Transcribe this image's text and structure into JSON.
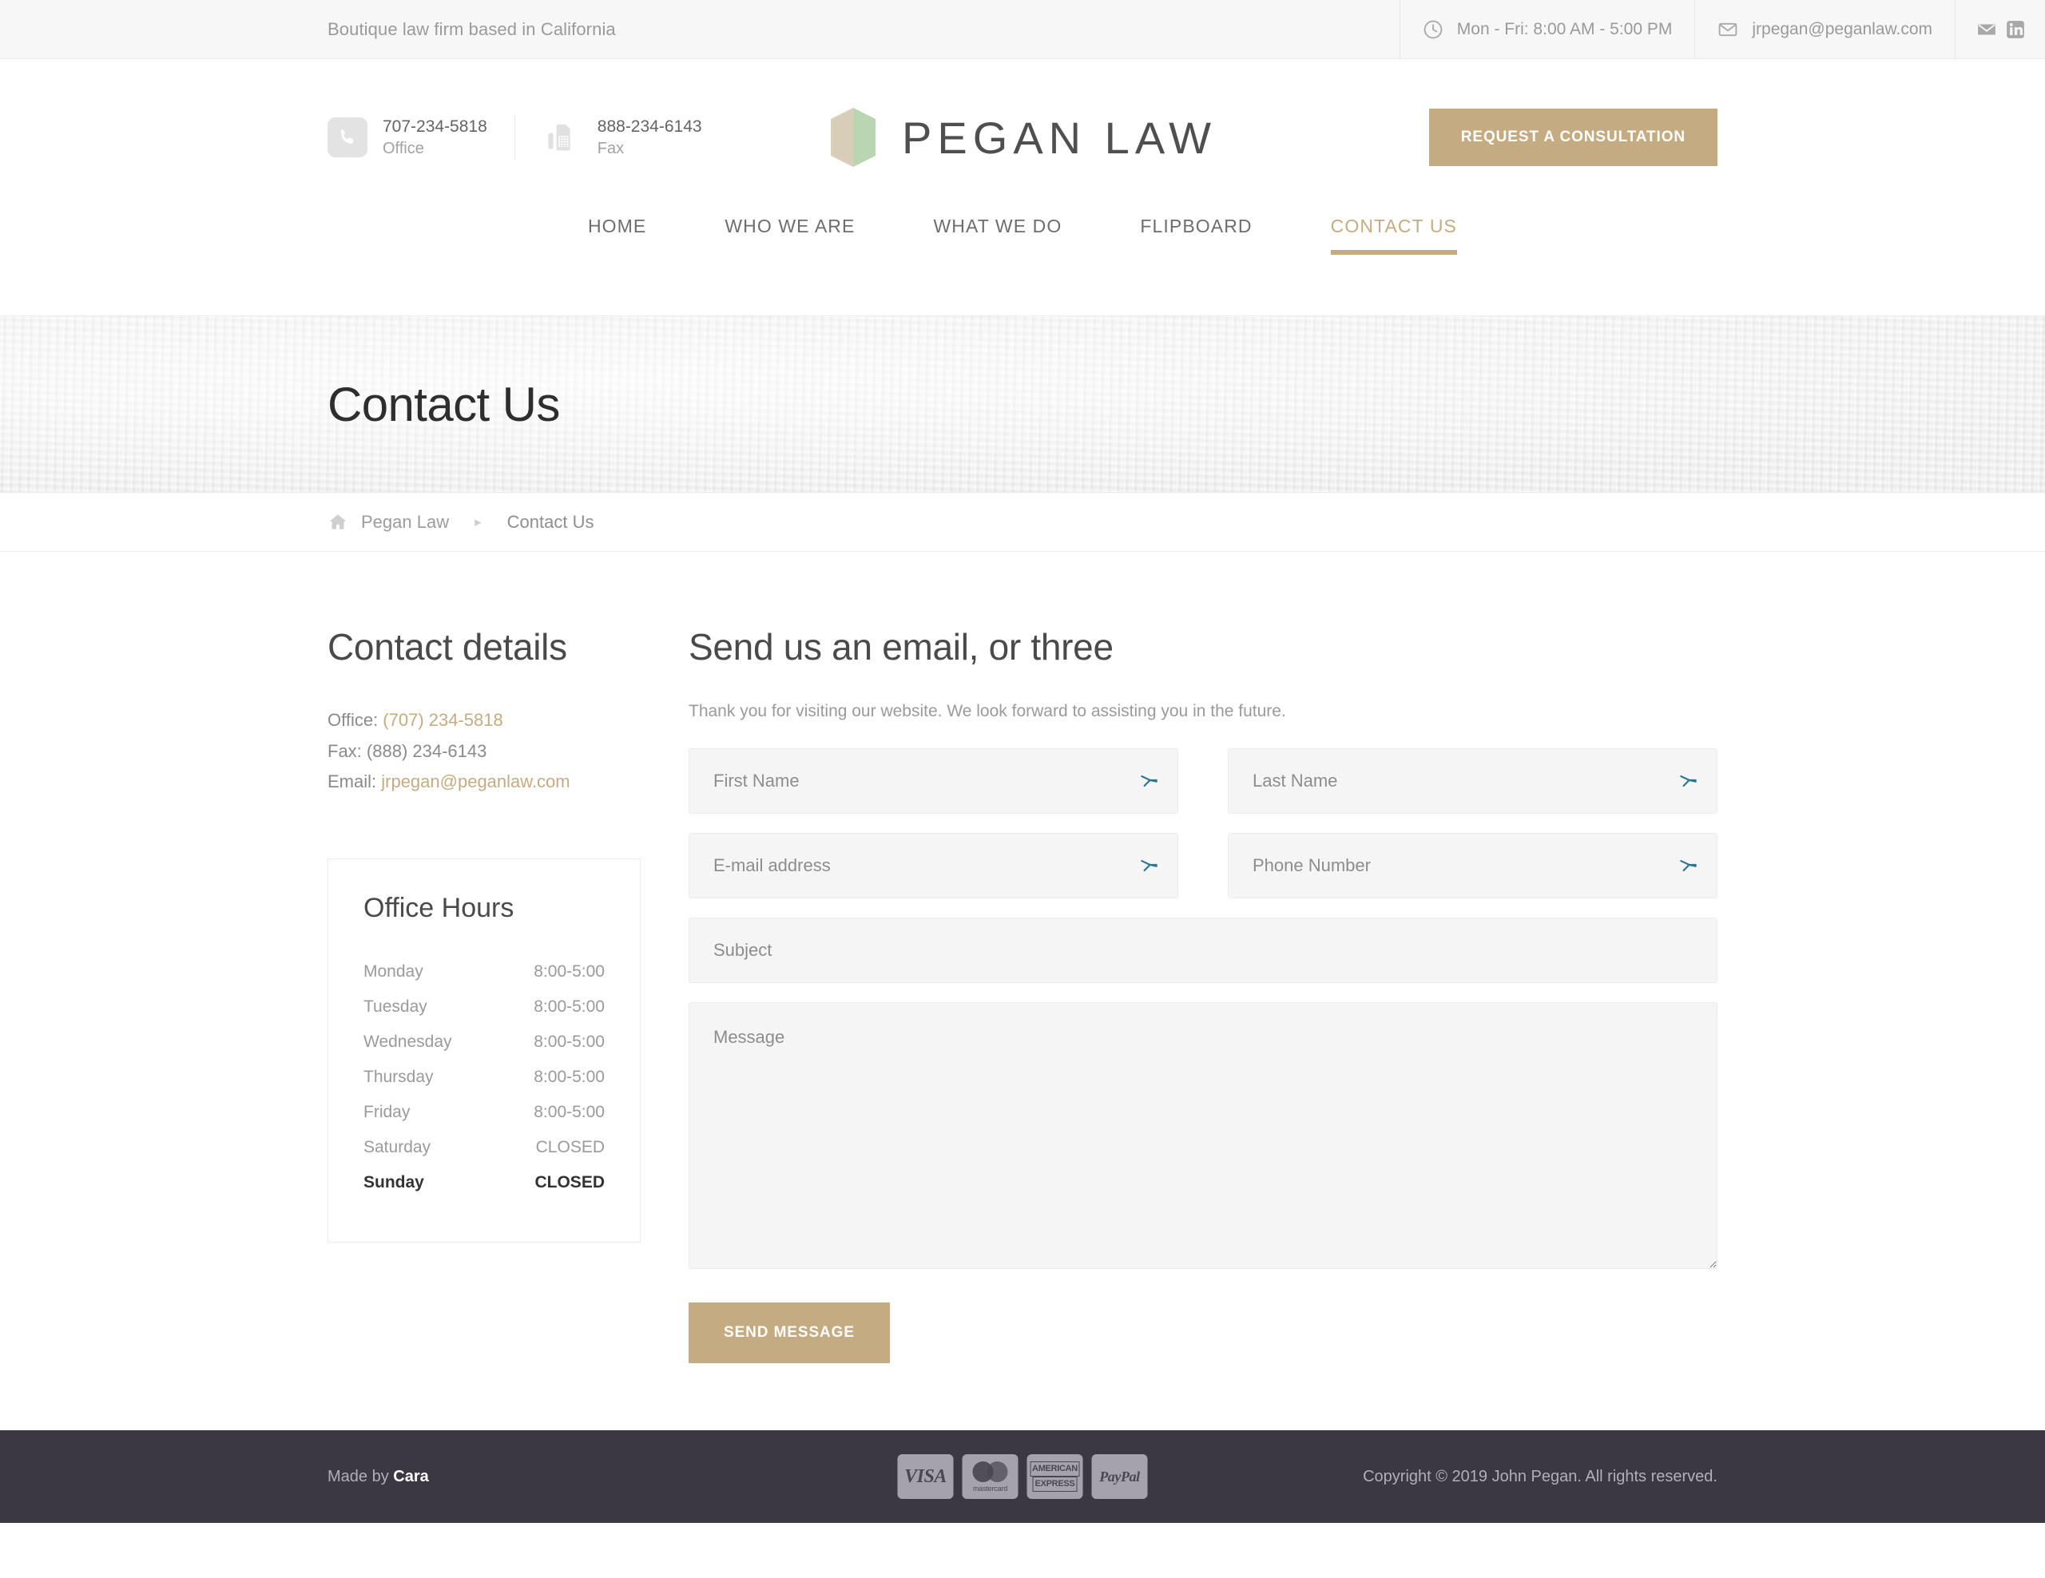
{
  "topbar": {
    "tagline": "Boutique law firm based in California",
    "hours": "Mon - Fri: 8:00 AM - 5:00 PM",
    "email": "jrpegan@peganlaw.com",
    "hours_icon": "clock-icon",
    "email_icon": "envelope-icon",
    "social": [
      {
        "name": "email-icon",
        "label": "Email"
      },
      {
        "name": "linkedin-icon",
        "label": "LinkedIn"
      }
    ]
  },
  "header": {
    "office_number": "707-234-5818",
    "office_label": "Office",
    "fax_number": "888-234-6143",
    "fax_label": "Fax",
    "brand": "PEGAN LAW",
    "cta_label": "REQUEST A CONSULTATION",
    "logo_left_color": "#d8cdb9",
    "logo_right_color": "#bad6b1",
    "accent_color": "#c5ab81"
  },
  "nav": {
    "items": [
      {
        "label": "HOME",
        "active": false
      },
      {
        "label": "WHO WE ARE",
        "active": false
      },
      {
        "label": "WHAT WE DO",
        "active": false
      },
      {
        "label": "FLIPBOARD",
        "active": false
      },
      {
        "label": "CONTACT US",
        "active": true
      }
    ]
  },
  "banner": {
    "title": "Contact Us"
  },
  "breadcrumb": {
    "home_icon": "home-icon",
    "items": [
      {
        "label": "Pegan Law",
        "current": false
      },
      {
        "label": "Contact Us",
        "current": true
      }
    ],
    "separator": "▸"
  },
  "contact_details": {
    "title": "Contact details",
    "office_prefix": "Office: ",
    "office_value": "(707) 234-5818",
    "fax_prefix": "Fax: ",
    "fax_value": "(888) 234-6143",
    "email_prefix": "Email: ",
    "email_value": "jrpegan@peganlaw.com"
  },
  "office_hours": {
    "title": "Office Hours",
    "rows": [
      {
        "day": "Monday",
        "hours": "8:00-5:00",
        "today": false
      },
      {
        "day": "Tuesday",
        "hours": "8:00-5:00",
        "today": false
      },
      {
        "day": "Wednesday",
        "hours": "8:00-5:00",
        "today": false
      },
      {
        "day": "Thursday",
        "hours": "8:00-5:00",
        "today": false
      },
      {
        "day": "Friday",
        "hours": "8:00-5:00",
        "today": false
      },
      {
        "day": "Saturday",
        "hours": "CLOSED",
        "today": false
      },
      {
        "day": "Sunday",
        "hours": "CLOSED",
        "today": true
      }
    ]
  },
  "form": {
    "title": "Send us an email, or three",
    "intro": "Thank you for visiting our website. We look forward to assisting you in the future.",
    "first_name_placeholder": "First Name",
    "last_name_placeholder": "Last Name",
    "email_placeholder": "E-mail address",
    "phone_placeholder": "Phone Number",
    "subject_placeholder": "Subject",
    "message_placeholder": "Message",
    "field_icon": "arrow-pointer-icon",
    "submit_label": "SEND MESSAGE"
  },
  "footer": {
    "made_by_prefix": "Made by ",
    "made_by_name": "Cara",
    "copyright": "Copyright © 2019 John Pegan. All rights reserved.",
    "payments": [
      {
        "name": "visa-icon",
        "label": "VISA"
      },
      {
        "name": "mastercard-icon",
        "label": "mastercard"
      },
      {
        "name": "amex-icon",
        "label_top": "AMERICAN",
        "label_bottom": "EXPRESS"
      },
      {
        "name": "paypal-icon",
        "label": "PayPal"
      }
    ]
  }
}
